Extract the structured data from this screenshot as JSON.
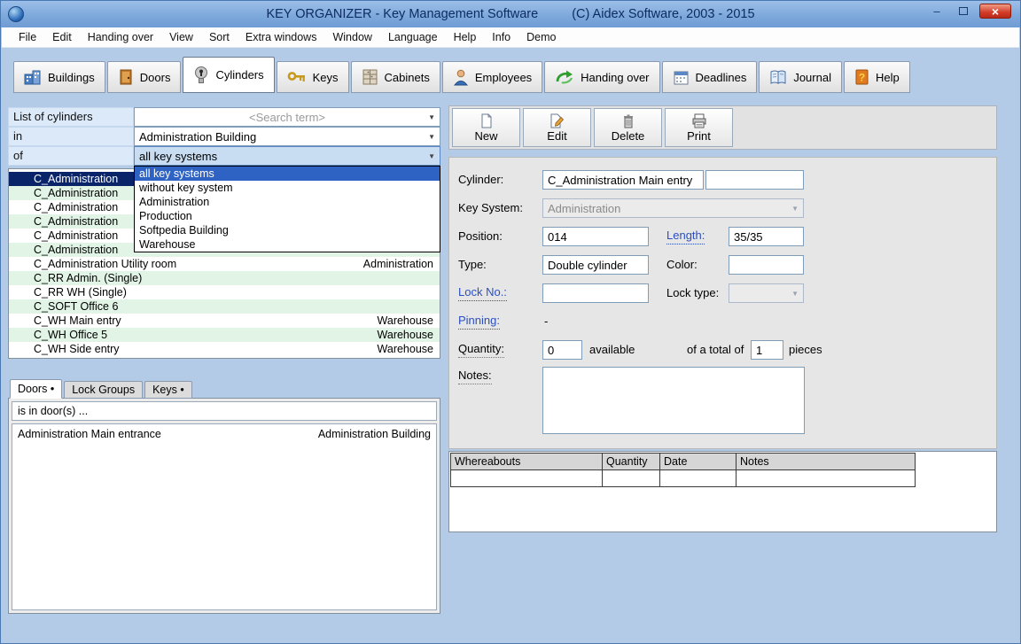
{
  "colors": {
    "titlebar_blue": "#7ea9dc",
    "selection_navy": "#0a246a",
    "dropdown_highlight": "#2e63c4",
    "row_green": "#e1f4e6",
    "link_blue": "#2b4fc0",
    "close_red": "#d23b28"
  },
  "window": {
    "title_main": "KEY ORGANIZER  -  Key Management Software",
    "title_copyright": "(C) Aidex Software, 2003 - 2015",
    "minimize_glyph": "–",
    "close_glyph": "×"
  },
  "menu": {
    "items": [
      "File",
      "Edit",
      "Handing over",
      "View",
      "Sort",
      "Extra windows",
      "Window",
      "Language",
      "Help",
      "Info",
      "Demo"
    ]
  },
  "tabs": [
    {
      "label": "Buildings"
    },
    {
      "label": "Doors"
    },
    {
      "label": "Cylinders"
    },
    {
      "label": "Keys"
    },
    {
      "label": "Cabinets"
    },
    {
      "label": "Employees"
    },
    {
      "label": "Handing over"
    },
    {
      "label": "Deadlines"
    },
    {
      "label": "Journal"
    },
    {
      "label": "Help"
    }
  ],
  "filters": {
    "list_label": "List of cylinders",
    "search_value": "<Search term>",
    "in_label": "in",
    "building_value": "Administration Building",
    "of_label": "of",
    "system_value": "all key systems"
  },
  "system_dropdown": {
    "items": [
      "all key systems",
      "without key system",
      "Administration",
      "Production",
      "Softpedia Building",
      "Warehouse"
    ]
  },
  "cylinders": {
    "rows": [
      {
        "name": "C_Administration",
        "system": ""
      },
      {
        "name": "C_Administration",
        "system": ""
      },
      {
        "name": "C_Administration",
        "system": ""
      },
      {
        "name": "C_Administration",
        "system": ""
      },
      {
        "name": "C_Administration",
        "system": ""
      },
      {
        "name": "C_Administration",
        "system": ""
      },
      {
        "name": "C_Administration Utility room",
        "system": "Administration"
      },
      {
        "name": "C_RR Admin. (Single)",
        "system": ""
      },
      {
        "name": "C_RR WH (Single)",
        "system": ""
      },
      {
        "name": "C_SOFT Office 6",
        "system": ""
      },
      {
        "name": "C_WH Main entry",
        "system": "Warehouse"
      },
      {
        "name": "C_WH Office 5",
        "system": "Warehouse"
      },
      {
        "name": "C_WH Side entry",
        "system": "Warehouse"
      }
    ]
  },
  "sub_tabs": [
    {
      "label": "Doors •"
    },
    {
      "label": "Lock Groups"
    },
    {
      "label": "Keys •"
    }
  ],
  "doors_panel": {
    "header": "is in door(s) ...",
    "rows": [
      {
        "name": "Administration Main entrance",
        "building": "Administration Building"
      }
    ]
  },
  "actions": [
    {
      "label": "New"
    },
    {
      "label": "Edit"
    },
    {
      "label": "Delete"
    },
    {
      "label": "Print"
    }
  ],
  "form": {
    "cylinder_label": "Cylinder:",
    "cylinder_value": "C_Administration Main entry",
    "cylinder_value2": "",
    "key_system_label": "Key System:",
    "key_system_value": "Administration",
    "position_label": "Position:",
    "position_value": "014",
    "length_label": "Length:",
    "length_value": "35/35",
    "type_label": "Type:",
    "type_value": "Double cylinder",
    "color_label": "Color:",
    "color_value": "",
    "lock_no_label": "Lock No.:",
    "lock_no_value": "",
    "lock_type_label": "Lock type:",
    "lock_type_value": "",
    "pinning_label": "Pinning:",
    "pinning_value": "-",
    "quantity_label": "Quantity:",
    "quantity_value": "0",
    "quantity_suffix": "available",
    "total_prefix": "of a total of",
    "total_value": "1",
    "total_suffix": "pieces",
    "notes_label": "Notes:",
    "notes_value": ""
  },
  "whereabouts": {
    "headers": [
      "Whereabouts",
      "Quantity",
      "Date",
      "Notes"
    ]
  }
}
